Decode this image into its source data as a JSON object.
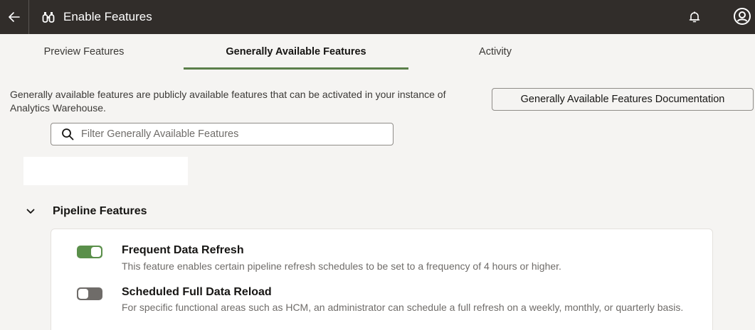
{
  "header": {
    "title": "Enable Features",
    "title_icon": "binoculars-icon",
    "back_icon": "arrow-left-icon",
    "bell_icon": "bell-icon",
    "avatar_icon": "user-avatar-icon",
    "background": "#312d2a"
  },
  "tabs": [
    {
      "label": "Preview Features",
      "active": false
    },
    {
      "label": "Generally Available Features",
      "active": true
    },
    {
      "label": "Activity",
      "active": false
    }
  ],
  "intro": {
    "description": "Generally available features are publicly available features that can be activated in your instance of Analytics Warehouse.",
    "doc_button": "Generally Available Features Documentation"
  },
  "filter": {
    "placeholder": "Filter Generally Available Features",
    "value": ""
  },
  "section": {
    "title": "Pipeline Features",
    "expanded": true,
    "features": [
      {
        "title": "Frequent Data Refresh",
        "description": "This feature enables certain pipeline refresh schedules to be set to a frequency of 4 hours or higher.",
        "enabled": true
      },
      {
        "title": "Scheduled Full Data Reload",
        "description": "For specific functional areas such as HCM, an administrator can schedule a full refresh on a weekly, monthly, or quarterly basis.",
        "enabled": false
      }
    ]
  },
  "colors": {
    "accent": "#5a7f4a",
    "toggle_on": "#5a8f4a",
    "toggle_off": "#6f6c69",
    "page_bg": "#f5f4f2"
  }
}
